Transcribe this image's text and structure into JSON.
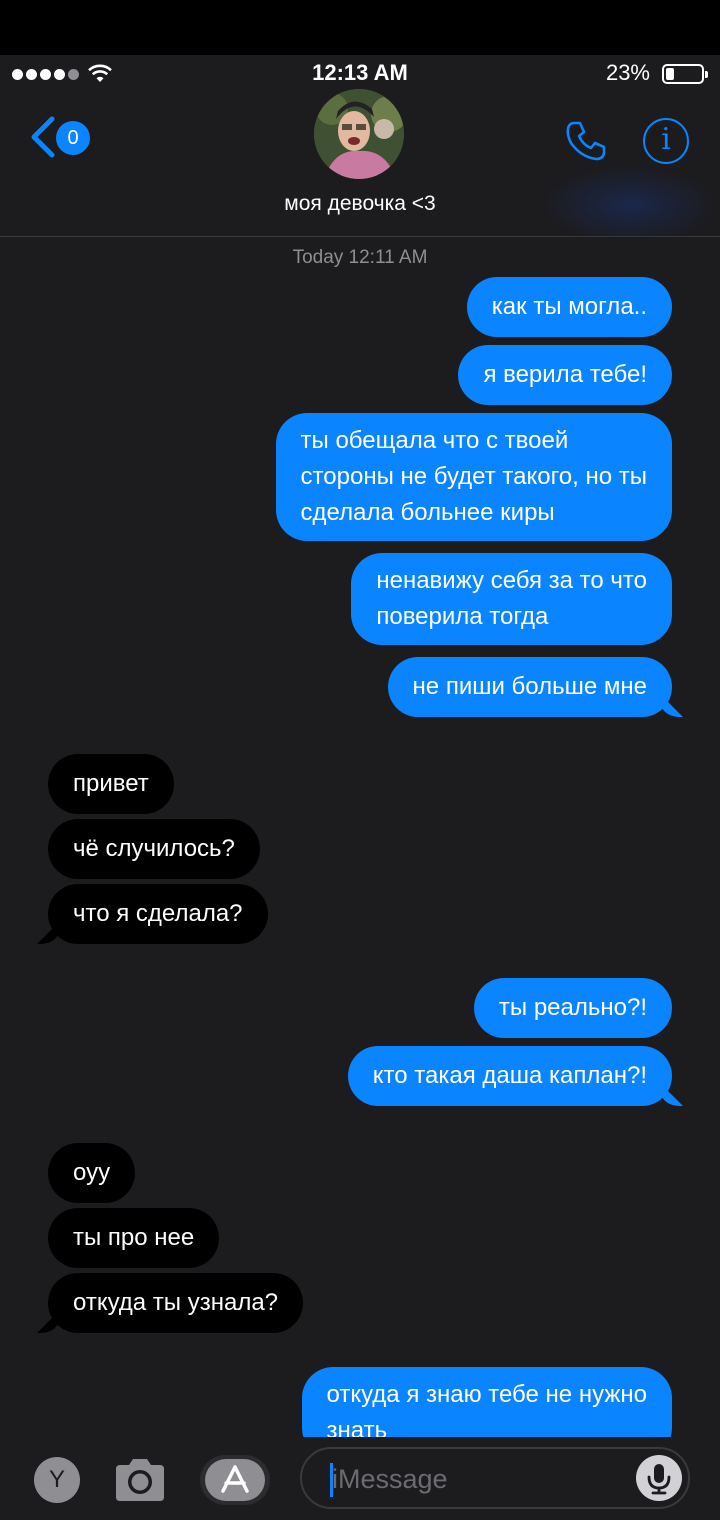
{
  "status": {
    "time": "12:13 AM",
    "battery": "23%"
  },
  "header": {
    "back_badge": "0",
    "contact_name": "моя девочка <3",
    "info_glyph": "i"
  },
  "conversation": {
    "timestamp": "Today 12:11 AM",
    "messages": [
      {
        "from": "me",
        "lines": [
          "как ты могла.."
        ]
      },
      {
        "from": "me",
        "lines": [
          "я верила тебе!"
        ]
      },
      {
        "from": "me",
        "lines": [
          "ты обещала что с твоей",
          "стороны не будет такого, но ты",
          "сделала больнее киры"
        ]
      },
      {
        "from": "me",
        "lines": [
          "ненавижу себя за то что",
          "поверила тогда"
        ]
      },
      {
        "from": "me",
        "lines": [
          "не пиши больше мне"
        ]
      },
      {
        "from": "them",
        "lines": [
          "привет"
        ]
      },
      {
        "from": "them",
        "lines": [
          "чё случилось?"
        ]
      },
      {
        "from": "them",
        "lines": [
          "что я сделала?"
        ]
      },
      {
        "from": "me",
        "lines": [
          "ты реально?!"
        ]
      },
      {
        "from": "me",
        "lines": [
          "кто такая даша каплан?!"
        ]
      },
      {
        "from": "them",
        "lines": [
          "оуу"
        ]
      },
      {
        "from": "them",
        "lines": [
          "ты про нее"
        ]
      },
      {
        "from": "them",
        "lines": [
          "откуда ты узнала?"
        ]
      },
      {
        "from": "me",
        "lines": [
          "откуда я знаю тебе не нужно",
          "знать"
        ]
      }
    ]
  },
  "input": {
    "placeholder": "iMessage",
    "app_label": "Y"
  },
  "icons": {
    "back": "chevron-left-icon",
    "call": "phone-icon",
    "info": "info-icon",
    "camera": "camera-icon",
    "appstore": "app-store-icon",
    "mic": "microphone-icon"
  },
  "colors": {
    "accent": "#0b84ff",
    "background": "#1c1b1e",
    "received_bubble": "#000000",
    "sent_bubble": "#0b84ff"
  }
}
